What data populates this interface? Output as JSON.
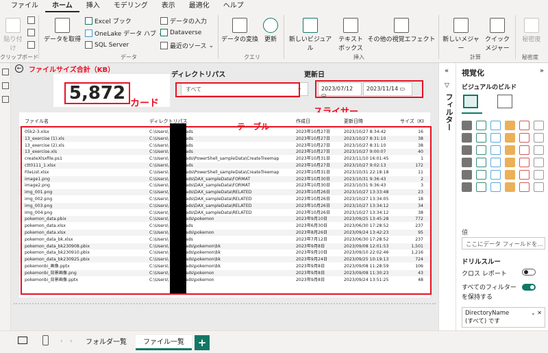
{
  "menu": [
    "ファイル",
    "ホーム",
    "挿入",
    "モデリング",
    "表示",
    "最適化",
    "ヘルプ"
  ],
  "ribbon": {
    "paste": "貼り付け",
    "clipboard": "クリップボード",
    "get_data": "データを取得",
    "excel": "Excel ブック",
    "onelake": "OneLake データ ハブ",
    "sql": "SQL Server",
    "enter_data": "データの入力",
    "dataverse": "Dataverse",
    "recent": "最近のソース",
    "data_group": "データ",
    "transform": "データの変換",
    "refresh": "更新",
    "query_group": "クエリ",
    "new_visual": "新しいビジュアル",
    "textbox": "テキスト ボックス",
    "more_visuals": "その他の視覚エフェクト",
    "insert_group": "挿入",
    "new_measure": "新しいメジャー",
    "quick_measure": "クイック メジャー",
    "calc_group": "計算",
    "sensitivity": "秘密度",
    "sensitivity_group": "秘密度"
  },
  "canvas": {
    "title_annotation": "ファイルサイズ合計（KB）",
    "card_value": "5,872",
    "card_annotation": "カード",
    "dir_label": "ディレクトリパス",
    "dir_value": "すべて",
    "date_label": "更新日",
    "date_from": "2023/07/12",
    "date_to": "2023/11/14",
    "slicer_annotation": "スライサー",
    "table_annotation": "テーブル"
  },
  "table": {
    "headers": [
      "ファイル名",
      "ディレクトリパス",
      "作成日",
      "更新日時",
      "サイズ（KB）"
    ],
    "rows": [
      [
        "05k2-3.xlsx",
        "C:\\Users\\          Downloads",
        "2023年10月27日",
        "2023/10/27 8:34:42",
        "16"
      ],
      [
        "13_exercise (1).xls",
        "C:\\Users\\          Downloads",
        "2023年10月27日",
        "2023/10/27 8:31:10",
        "38"
      ],
      [
        "13_exercise (2).xls",
        "C:\\Users\\          Downloads",
        "2023年10月27日",
        "2023/10/27 8:31:10",
        "38"
      ],
      [
        "13_exercise.xls",
        "C:\\Users\\          Downloads",
        "2023年10月27日",
        "2023/10/27 9:00:07",
        "40"
      ],
      [
        "createXlsxfile.ps1",
        "C:\\Users\\          Downloads\\PowerShell_sampleData\\CreateTreemap",
        "2023年10月31日",
        "2023/11/10 16:01:45",
        "1"
      ],
      [
        "ctt0111_1.xlsx",
        "C:\\Users\\          Downloads",
        "2023年10月27日",
        "2023/10/27 9:02:13",
        "172"
      ],
      [
        "FileList.xlsx",
        "C:\\Users\\          Downloads\\PowerShell_sampleData\\CreateTreemap",
        "2023年10月31日",
        "2023/10/31 22:18:18",
        "11"
      ],
      [
        "image1.png",
        "C:\\Users\\          Downloads\\DAX_sampleData\\FORMAT",
        "2023年10月30日",
        "2023/10/31 9:36:43",
        "2"
      ],
      [
        "image2.png",
        "C:\\Users\\          Downloads\\DAX_sampleData\\FORMAT",
        "2023年10月30日",
        "2023/10/31 9:36:43",
        "3"
      ],
      [
        "img_001.png",
        "C:\\Users\\          Downloads\\DAX_sampleData\\RELATED",
        "2023年10月26日",
        "2023/10/27 13:33:48",
        "23"
      ],
      [
        "img_002.png",
        "C:\\Users\\          Downloads\\DAX_sampleData\\RELATED",
        "2023年10月26日",
        "2023/10/27 13:34:05",
        "18"
      ],
      [
        "img_003.png",
        "C:\\Users\\          Downloads\\DAX_sampleData\\RELATED",
        "2023年10月26日",
        "2023/10/27 13:34:12",
        "34"
      ],
      [
        "img_004.png",
        "C:\\Users\\          Downloads\\DAX_sampleData\\RELATED",
        "2023年10月26日",
        "2023/10/27 13:34:12",
        "38"
      ],
      [
        "pokemon_data.pbix",
        "C:\\Users\\          Downloads\\pokemon",
        "2023年9月10日",
        "2023/09/25 13:45:28",
        "772"
      ],
      [
        "pokemon_data.xlsx",
        "C:\\Users\\          Downloads",
        "2023年6月30日",
        "2023/06/30 17:28:52",
        "237"
      ],
      [
        "pokemon_data.xlsx",
        "C:\\Users\\          Downloads\\pokemon",
        "2023年8月26日",
        "2023/09/24 13:42:23",
        "95"
      ],
      [
        "pokemon_data_bk.xlsx",
        "C:\\Users\\          Downloads",
        "2023年7月12日",
        "2023/06/30 17:28:52",
        "237"
      ],
      [
        "pokemon_data_bk230908.pbix",
        "C:\\Users\\          Downloads\\pokemon\\bk",
        "2023年9月8日",
        "2023/09/08 12:01:53",
        "1,501"
      ],
      [
        "pokemon_data_bk230910.pbix",
        "C:\\Users\\          Downloads\\pokemon\\bk",
        "2023年9月10日",
        "2023/09/10 22:02:46",
        "1,216"
      ],
      [
        "pokemon_data_bk230925.pbix",
        "C:\\Users\\          Downloads\\pokemon\\bk",
        "2023年9月24日",
        "2023/09/25 10:19:13",
        "724"
      ],
      [
        "pokemonbi_画像.pptx",
        "C:\\Users\\          Downloads\\pokemon\\bk",
        "2023年9月8日",
        "2023/09/08 11:28:59",
        "106"
      ],
      [
        "pokemonbi_背景画像.png",
        "C:\\Users\\          Downloads\\pokemon",
        "2023年9月8日",
        "2023/09/08 11:30:23",
        "43"
      ],
      [
        "pokemonbi_背景画像.pptx",
        "C:\\Users\\          Downloads\\pokemon",
        "2023年9月8日",
        "2023/09/24 13:51:25",
        "48"
      ]
    ]
  },
  "filters_label": "フィルター",
  "viz": {
    "title": "視覚化",
    "build": "ビジュアルのビルド",
    "values_label": "値",
    "field_placeholder": "ここにデータ フィールドを...",
    "drill_title": "ドリルスルー",
    "cross_report": "クロス レポート",
    "keep_filters_1": "すべてのフィルター",
    "keep_filters_2": "を保持する",
    "cross_state": "オフ",
    "keep_state": "オン",
    "filter_field": "DirectoryName",
    "filter_value": "(すべて) です",
    "tile_colors": [
      "#605e5c",
      "#117865",
      "#3b9bd9",
      "#e8a33b",
      "#c83e3e",
      "#8a8886"
    ]
  },
  "pages": [
    "フォルダ一覧",
    "ファイル一覧"
  ],
  "add_page": "+",
  "accent": "#117865",
  "annotation_color": "#e81123"
}
